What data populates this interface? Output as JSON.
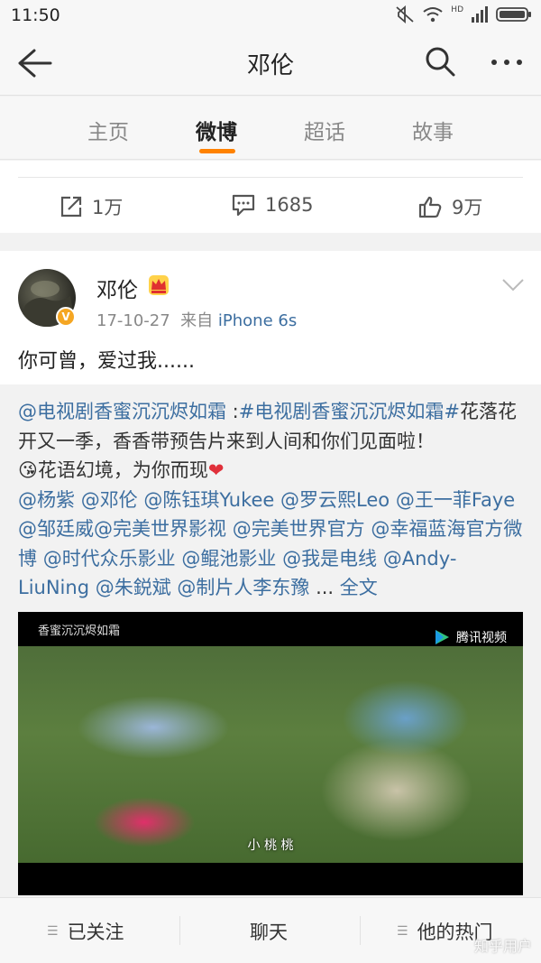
{
  "status_bar": {
    "time": "11:50",
    "network_label": "HD"
  },
  "nav": {
    "title": "邓伦"
  },
  "tabs": [
    {
      "label": "主页"
    },
    {
      "label": "微博"
    },
    {
      "label": "超话"
    },
    {
      "label": "故事"
    }
  ],
  "active_tab_index": 1,
  "prev_post_actions": {
    "repost": "1万",
    "comment": "1685",
    "like": "9万"
  },
  "post": {
    "author": "邓伦",
    "date": "17-10-27",
    "source_prefix": "来自",
    "source": "iPhone 6s",
    "text": "你可曾，爱过我......",
    "repost": {
      "line1_mention": "@电视剧香蜜沉沉烬如霜",
      "line1_colon": " :",
      "line1_topic": "#电视剧香蜜沉沉烬如霜#",
      "line1_rest": "花落花开又一季，香香带预告片来到人间和你们见面啦！",
      "line2": "花语幻境，为你而现",
      "heart": "❤",
      "mentions": [
        "@杨紫",
        "@邓伦",
        "@陈钰琪Yukee",
        "@罗云熙Leo",
        "@王一菲Faye",
        "@邹廷威",
        "@完美世界影视",
        "@完美世界官方",
        "@幸福蓝海官方微博",
        "@时代众乐影业",
        "@鲲池影业",
        "@我是电线",
        "@Andy-LiuNing",
        "@朱鋭斌",
        "@制片人李东豫"
      ],
      "ellipsis": " ...",
      "full_text": "全文"
    },
    "video": {
      "watermark": "香蜜沉沉烬如霜",
      "platform": "腾讯视频",
      "subtitle": "小 桃 桃"
    }
  },
  "bottom_bar": {
    "follow": "已关注",
    "chat": "聊天",
    "hot": "他的热门"
  },
  "watermark": "知乎用户",
  "colors": {
    "accent": "#ff8200",
    "link": "#3c6ea0",
    "heart": "#e0303a"
  }
}
